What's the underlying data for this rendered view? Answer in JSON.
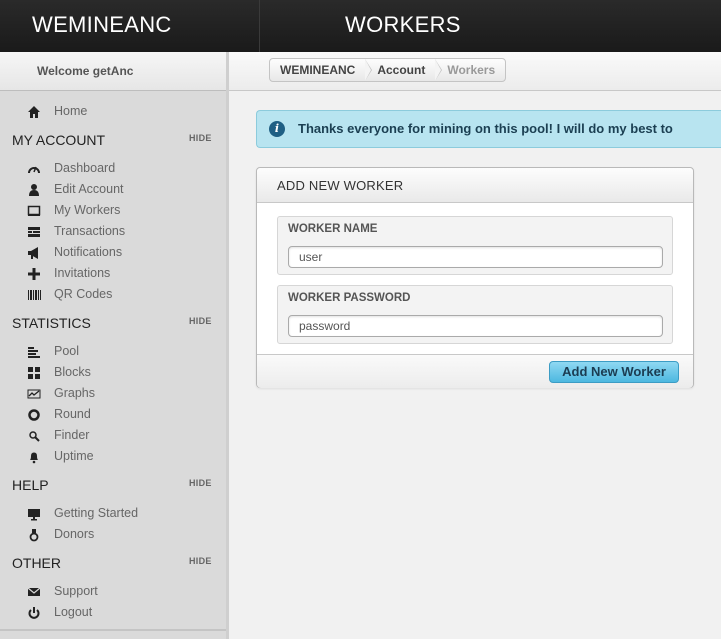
{
  "header": {
    "brand": "WEMINEANC",
    "page_title": "WORKERS"
  },
  "sidebar": {
    "welcome": "Welcome getAnc",
    "home": {
      "label": "Home",
      "icon": "home-icon"
    },
    "sections": [
      {
        "title": "MY ACCOUNT",
        "hide": "HIDE",
        "items": [
          {
            "label": "Dashboard",
            "icon": "dashboard-icon"
          },
          {
            "label": "Edit Account",
            "icon": "user-icon"
          },
          {
            "label": "My Workers",
            "icon": "monitor-icon"
          },
          {
            "label": "Transactions",
            "icon": "list-icon"
          },
          {
            "label": "Notifications",
            "icon": "megaphone-icon"
          },
          {
            "label": "Invitations",
            "icon": "plus-icon"
          },
          {
            "label": "QR Codes",
            "icon": "barcode-icon"
          }
        ]
      },
      {
        "title": "STATISTICS",
        "hide": "HIDE",
        "items": [
          {
            "label": "Pool",
            "icon": "bars-icon"
          },
          {
            "label": "Blocks",
            "icon": "grid-icon"
          },
          {
            "label": "Graphs",
            "icon": "chart-icon"
          },
          {
            "label": "Round",
            "icon": "circle-icon"
          },
          {
            "label": "Finder",
            "icon": "search-icon"
          },
          {
            "label": "Uptime",
            "icon": "bell-icon"
          }
        ]
      },
      {
        "title": "HELP",
        "hide": "HIDE",
        "items": [
          {
            "label": "Getting Started",
            "icon": "desktop-icon"
          },
          {
            "label": "Donors",
            "icon": "medal-icon"
          }
        ]
      },
      {
        "title": "OTHER",
        "hide": "HIDE",
        "items": [
          {
            "label": "Support",
            "icon": "mail-icon"
          },
          {
            "label": "Logout",
            "icon": "power-icon"
          }
        ]
      }
    ]
  },
  "breadcrumb": [
    "WEMINEANC",
    "Account",
    "Workers"
  ],
  "alert": {
    "message": "Thanks everyone for mining on this pool! I will do my best to"
  },
  "panel": {
    "title": "ADD NEW WORKER",
    "worker_name_label": "WORKER NAME",
    "worker_name_value": "user",
    "worker_password_label": "WORKER PASSWORD",
    "worker_password_value": "password",
    "submit_label": "Add New Worker"
  }
}
